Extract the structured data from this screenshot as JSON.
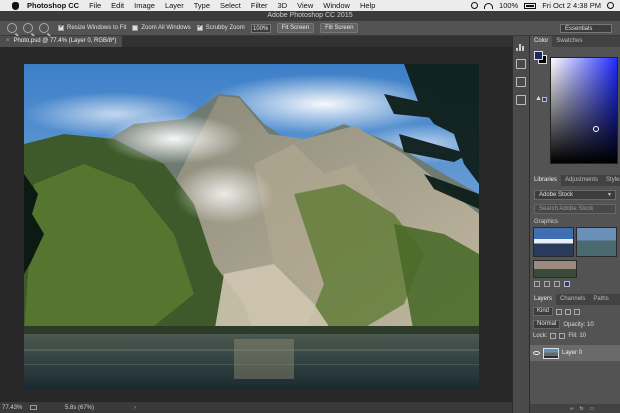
{
  "menubar": {
    "app": "Photoshop CC",
    "items": [
      "File",
      "Edit",
      "Image",
      "Layer",
      "Type",
      "Select",
      "Filter",
      "3D",
      "View",
      "Window",
      "Help"
    ],
    "battery": "100%",
    "clock": "Fri Oct 2  4:38 PM"
  },
  "window": {
    "title": "Adobe Photoshop CC 2015"
  },
  "options": {
    "resize_windows": "Resize Windows to Fit",
    "zoom_all": "Zoom All Windows",
    "scrubby_zoom": "Scrubby Zoom",
    "zoom_value": "100%",
    "fit_screen": "Fit Screen",
    "fill_screen": "Fill Screen",
    "workspace": "Essentials"
  },
  "document": {
    "tab_title": "Photo.psd @ 77.4% (Layer 0, RGB/8*)",
    "close": "×"
  },
  "status": {
    "zoom": "77.43%",
    "doc_size": "5.8s (67%)",
    "arrow": "›"
  },
  "panels": {
    "color_tabs": [
      "Color",
      "Swatches"
    ],
    "colors": {
      "foreground": "#1c2a64",
      "background": "#000000"
    },
    "library_tabs": [
      "Libraries",
      "Adjustments",
      "Styles"
    ],
    "library_select": "Adobe Stock",
    "library_search": "Search Adobe Stock",
    "graphics_label": "Graphics",
    "layer_tabs": [
      "Layers",
      "Channels",
      "Paths"
    ],
    "kind_label": "Kind",
    "blend_mode": "Normal",
    "opacity_label": "Opacity: 10",
    "lock_label": "Lock:",
    "fill_label": "Fill: 10",
    "layer_name": "Layer 0"
  }
}
